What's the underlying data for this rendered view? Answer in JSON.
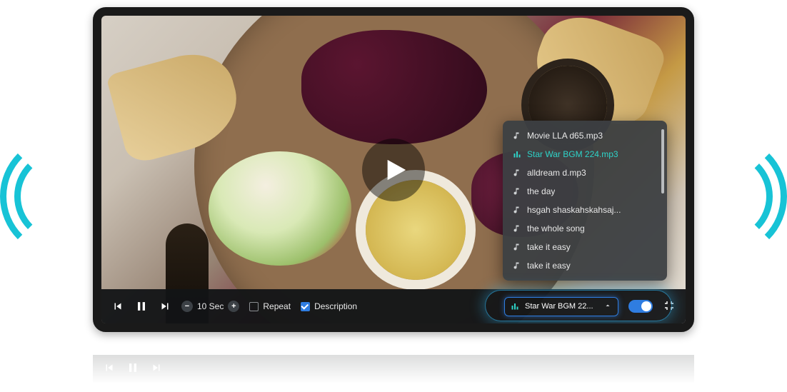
{
  "seek": {
    "amount": "10 Sec"
  },
  "repeat": {
    "label": "Repeat",
    "checked": false
  },
  "description": {
    "label": "Description",
    "checked": true
  },
  "track_select": {
    "current": "Star War BGM 22..."
  },
  "toggle": {
    "on": true
  },
  "playlist": {
    "items": [
      {
        "label": "Movie LLA d65.mp3",
        "active": false
      },
      {
        "label": "Star War BGM 224.mp3",
        "active": true
      },
      {
        "label": "alldream d.mp3",
        "active": false
      },
      {
        "label": "the day",
        "active": false
      },
      {
        "label": "hsgah shaskahskahsaj...",
        "active": false
      },
      {
        "label": "the whole song",
        "active": false
      },
      {
        "label": "take it easy",
        "active": false
      },
      {
        "label": "take it easy",
        "active": false
      }
    ]
  }
}
